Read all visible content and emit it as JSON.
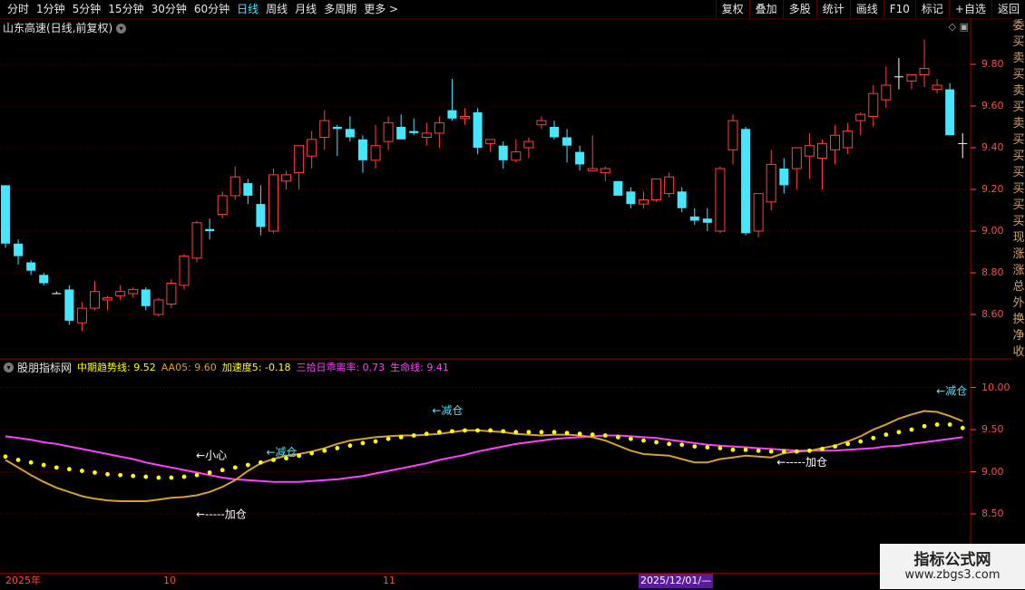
{
  "toolbar": {
    "periods": [
      "分时",
      "1分钟",
      "5分钟",
      "15分钟",
      "30分钟",
      "60分钟",
      "日线",
      "周线",
      "月线",
      "多周期",
      "更多 >"
    ],
    "active_period": "日线",
    "right_buttons": [
      "复权",
      "叠加",
      "多股",
      "统计",
      "画线",
      "F10",
      "标记",
      "+自选",
      "返回"
    ]
  },
  "stock": {
    "title": "山东高速(日线,前复权)"
  },
  "main_axis": {
    "ticks": [
      "9.80",
      "9.60",
      "9.40",
      "9.20",
      "9.00",
      "8.80",
      "8.60"
    ]
  },
  "indicator": {
    "name": "股朋指标网",
    "values": [
      {
        "label": "中期趋势线: 9.52",
        "color": "#ffff00"
      },
      {
        "label": "AA05: 9.60",
        "color": "#d4a030"
      },
      {
        "label": "加速度5: -0.18",
        "color": "#ffff00"
      },
      {
        "label": "三拾日乖离率: 0.73",
        "color": "#ff40ff"
      },
      {
        "label": "生命线: 9.41",
        "color": "#ff40ff"
      }
    ],
    "axis_ticks": [
      "10.00",
      "9.50",
      "9.00",
      "8.50"
    ],
    "annotations": {
      "reduce": "←减仓",
      "careful": "←小心",
      "add": "←-----加仓"
    }
  },
  "time_axis": {
    "labels": [
      "2025年",
      "10",
      "11"
    ],
    "highlight": "2025/12/01/—"
  },
  "right_strip": {
    "chars": "委买卖买卖买卖买买买买买买现涨涨总外换净收"
  },
  "watermark": {
    "line1": "指标公式网",
    "line2": "www.zbgs3.com"
  },
  "colors": {
    "up": "#ff4040",
    "down": "#46e6ff",
    "trend": "#ffff00",
    "aa05": "#d4a030",
    "life": "#ff40ff"
  },
  "candles": [
    [
      9.22,
      9.22,
      8.92,
      8.94
    ],
    [
      8.94,
      8.96,
      8.84,
      8.88
    ],
    [
      8.85,
      8.86,
      8.79,
      8.81
    ],
    [
      8.79,
      8.8,
      8.74,
      8.75
    ],
    [
      8.7,
      8.71,
      8.7,
      8.7
    ],
    [
      8.72,
      8.74,
      8.55,
      8.57
    ],
    [
      8.56,
      8.66,
      8.52,
      8.63
    ],
    [
      8.63,
      8.76,
      8.62,
      8.71
    ],
    [
      8.67,
      8.69,
      8.62,
      8.68
    ],
    [
      8.69,
      8.74,
      8.67,
      8.71
    ],
    [
      8.7,
      8.73,
      8.68,
      8.72
    ],
    [
      8.72,
      8.73,
      8.62,
      8.64
    ],
    [
      8.6,
      8.68,
      8.59,
      8.67
    ],
    [
      8.65,
      8.77,
      8.63,
      8.75
    ],
    [
      8.74,
      8.89,
      8.72,
      8.88
    ],
    [
      8.87,
      9.05,
      8.85,
      9.04
    ],
    [
      9.01,
      9.06,
      8.96,
      9.0
    ],
    [
      9.08,
      9.19,
      9.06,
      9.17
    ],
    [
      9.17,
      9.31,
      9.15,
      9.26
    ],
    [
      9.23,
      9.25,
      9.13,
      9.17
    ],
    [
      9.13,
      9.22,
      8.98,
      9.02
    ],
    [
      9.0,
      9.3,
      8.99,
      9.27
    ],
    [
      9.24,
      9.29,
      9.2,
      9.27
    ],
    [
      9.28,
      9.37,
      9.2,
      9.41
    ],
    [
      9.36,
      9.48,
      9.3,
      9.44
    ],
    [
      9.45,
      9.58,
      9.39,
      9.53
    ],
    [
      9.5,
      9.51,
      9.36,
      9.49
    ],
    [
      9.49,
      9.55,
      9.43,
      9.45
    ],
    [
      9.44,
      9.46,
      9.28,
      9.34
    ],
    [
      9.34,
      9.51,
      9.3,
      9.41
    ],
    [
      9.43,
      9.55,
      9.39,
      9.52
    ],
    [
      9.5,
      9.56,
      9.45,
      9.44
    ],
    [
      9.48,
      9.54,
      9.46,
      9.47
    ],
    [
      9.45,
      9.52,
      9.41,
      9.47
    ],
    [
      9.47,
      9.55,
      9.4,
      9.52
    ],
    [
      9.58,
      9.73,
      9.53,
      9.54
    ],
    [
      9.54,
      9.59,
      9.51,
      9.55
    ],
    [
      9.57,
      9.59,
      9.37,
      9.4
    ],
    [
      9.42,
      9.44,
      9.38,
      9.44
    ],
    [
      9.41,
      9.43,
      9.3,
      9.34
    ],
    [
      9.34,
      9.44,
      9.33,
      9.38
    ],
    [
      9.4,
      9.45,
      9.35,
      9.43
    ],
    [
      9.51,
      9.55,
      9.49,
      9.53
    ],
    [
      9.5,
      9.53,
      9.44,
      9.45
    ],
    [
      9.45,
      9.49,
      9.33,
      9.41
    ],
    [
      9.38,
      9.41,
      9.29,
      9.32
    ],
    [
      9.29,
      9.46,
      9.29,
      9.3
    ],
    [
      9.28,
      9.31,
      9.24,
      9.3
    ],
    [
      9.24,
      9.24,
      9.18,
      9.17
    ],
    [
      9.19,
      9.21,
      9.11,
      9.13
    ],
    [
      9.13,
      9.19,
      9.11,
      9.15
    ],
    [
      9.15,
      9.25,
      9.14,
      9.25
    ],
    [
      9.18,
      9.28,
      9.16,
      9.26
    ],
    [
      9.19,
      9.21,
      9.09,
      9.11
    ],
    [
      9.07,
      9.11,
      9.03,
      9.05
    ],
    [
      9.06,
      9.11,
      9.0,
      9.04
    ],
    [
      9.0,
      9.31,
      8.99,
      9.3
    ],
    [
      9.39,
      9.56,
      9.32,
      9.53
    ],
    [
      9.49,
      9.5,
      8.98,
      8.99
    ],
    [
      9.0,
      9.01,
      8.97,
      9.18
    ],
    [
      9.14,
      9.39,
      9.1,
      9.32
    ],
    [
      9.3,
      9.35,
      9.18,
      9.22
    ],
    [
      9.3,
      9.4,
      9.2,
      9.4
    ],
    [
      9.36,
      9.47,
      9.25,
      9.41
    ],
    [
      9.35,
      9.44,
      9.2,
      9.42
    ],
    [
      9.39,
      9.51,
      9.32,
      9.46
    ],
    [
      9.4,
      9.52,
      9.37,
      9.48
    ],
    [
      9.53,
      9.57,
      9.46,
      9.56
    ],
    [
      9.55,
      9.7,
      9.5,
      9.66
    ],
    [
      9.63,
      9.79,
      9.59,
      9.7
    ],
    [
      9.74,
      9.83,
      9.68,
      9.74
    ],
    [
      9.72,
      9.75,
      9.68,
      9.75
    ],
    [
      9.75,
      9.92,
      9.69,
      9.78
    ],
    [
      9.68,
      9.73,
      9.66,
      9.7
    ],
    [
      9.68,
      9.71,
      9.5,
      9.46
    ],
    [
      9.42,
      9.47,
      9.35,
      9.42
    ]
  ],
  "series_trend": [
    9.18,
    9.14,
    9.11,
    9.08,
    9.05,
    9.03,
    9.01,
    8.99,
    8.97,
    8.96,
    8.95,
    8.94,
    8.93,
    8.93,
    8.94,
    8.96,
    8.99,
    9.02,
    9.05,
    9.08,
    9.11,
    9.14,
    9.16,
    9.19,
    9.22,
    9.25,
    9.28,
    9.31,
    9.34,
    9.36,
    9.39,
    9.41,
    9.43,
    9.45,
    9.47,
    9.48,
    9.49,
    9.49,
    9.49,
    9.48,
    9.47,
    9.47,
    9.47,
    9.47,
    9.46,
    9.45,
    9.44,
    9.43,
    9.41,
    9.39,
    9.37,
    9.35,
    9.33,
    9.32,
    9.3,
    9.29,
    9.28,
    9.26,
    9.26,
    9.25,
    9.24,
    9.24,
    9.24,
    9.25,
    9.27,
    9.3,
    9.33,
    9.36,
    9.4,
    9.44,
    9.47,
    9.5,
    9.54,
    9.56,
    9.56,
    9.52
  ],
  "series_aa05": [
    9.14,
    9.05,
    8.96,
    8.88,
    8.81,
    8.76,
    8.71,
    8.68,
    8.66,
    8.65,
    8.65,
    8.65,
    8.67,
    8.69,
    8.7,
    8.72,
    8.76,
    8.82,
    8.9,
    9.01,
    9.1,
    9.15,
    9.19,
    9.21,
    9.24,
    9.28,
    9.33,
    9.37,
    9.39,
    9.41,
    9.42,
    9.43,
    9.43,
    9.44,
    9.45,
    9.47,
    9.49,
    9.49,
    9.48,
    9.47,
    9.45,
    9.44,
    9.43,
    9.44,
    9.44,
    9.43,
    9.41,
    9.37,
    9.31,
    9.25,
    9.21,
    9.2,
    9.19,
    9.15,
    9.11,
    9.11,
    9.15,
    9.17,
    9.19,
    9.18,
    9.17,
    9.22,
    9.24,
    9.25,
    9.28,
    9.31,
    9.36,
    9.42,
    9.5,
    9.56,
    9.63,
    9.68,
    9.72,
    9.71,
    9.66,
    9.6
  ],
  "series_life": [
    9.42,
    9.4,
    9.38,
    9.35,
    9.33,
    9.3,
    9.27,
    9.24,
    9.21,
    9.18,
    9.15,
    9.11,
    9.08,
    9.05,
    9.02,
    8.99,
    8.96,
    8.93,
    8.91,
    8.9,
    8.89,
    8.88,
    8.88,
    8.88,
    8.89,
    8.9,
    8.91,
    8.93,
    8.95,
    8.98,
    9.01,
    9.04,
    9.07,
    9.1,
    9.14,
    9.17,
    9.2,
    9.24,
    9.27,
    9.3,
    9.33,
    9.35,
    9.37,
    9.39,
    9.4,
    9.41,
    9.42,
    9.43,
    9.43,
    9.42,
    9.41,
    9.4,
    9.38,
    9.36,
    9.34,
    9.32,
    9.31,
    9.3,
    9.29,
    9.28,
    9.27,
    9.26,
    9.25,
    9.25,
    9.25,
    9.25,
    9.26,
    9.27,
    9.28,
    9.3,
    9.31,
    9.33,
    9.35,
    9.37,
    9.39,
    9.41
  ]
}
